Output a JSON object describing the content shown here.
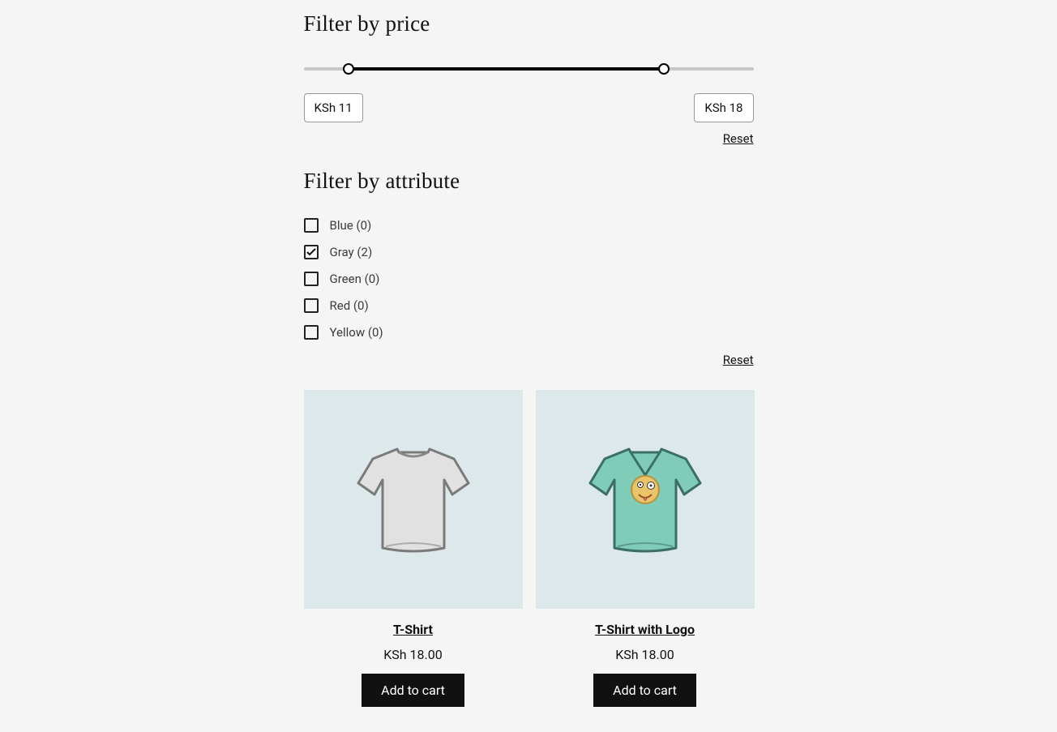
{
  "priceFilter": {
    "title": "Filter by price",
    "minLabel": "KSh 11",
    "maxLabel": "KSh 18",
    "resetLabel": "Reset",
    "minPct": 10,
    "maxPct": 80
  },
  "attributeFilter": {
    "title": "Filter by attribute",
    "resetLabel": "Reset",
    "items": [
      {
        "label": "Blue (0)",
        "checked": false
      },
      {
        "label": "Gray (2)",
        "checked": true
      },
      {
        "label": "Green (0)",
        "checked": false
      },
      {
        "label": "Red (0)",
        "checked": false
      },
      {
        "label": "Yellow (0)",
        "checked": false
      }
    ]
  },
  "products": [
    {
      "title": "T-Shirt",
      "price": "KSh 18.00",
      "button": "Add to cart",
      "variant": "plain"
    },
    {
      "title": "T-Shirt with Logo",
      "price": "KSh 18.00",
      "button": "Add to cart",
      "variant": "logo"
    }
  ]
}
